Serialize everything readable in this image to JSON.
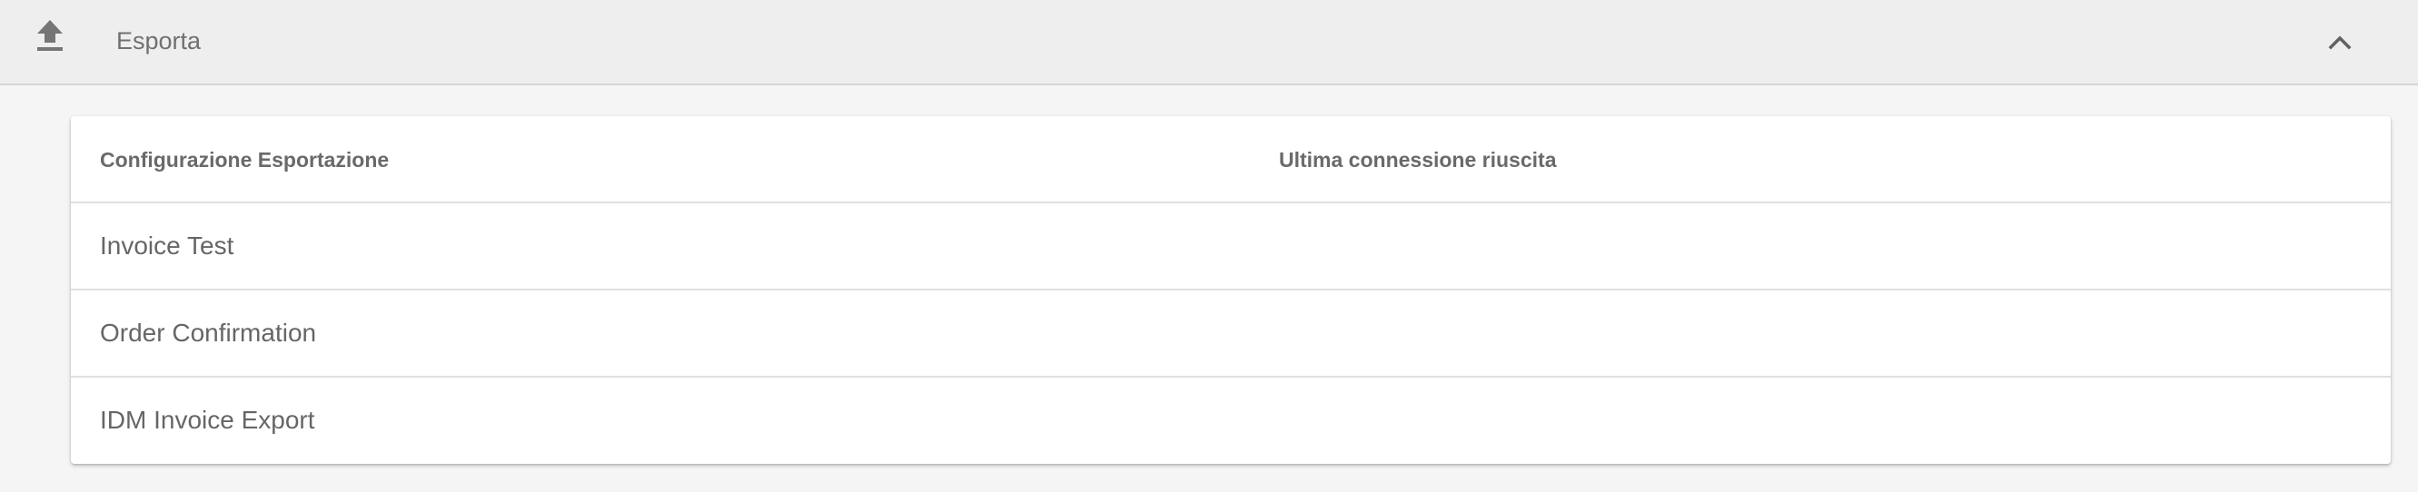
{
  "header": {
    "icon": "upload-icon",
    "title": "Esporta",
    "collapse_icon": "chevron-up-icon"
  },
  "table": {
    "columns": [
      "Configurazione Esportazione",
      "Ultima connessione riuscita"
    ],
    "rows": [
      {
        "name": "Invoice Test",
        "last_connection": ""
      },
      {
        "name": "Order Confirmation",
        "last_connection": ""
      },
      {
        "name": "IDM Invoice Export",
        "last_connection": ""
      }
    ]
  },
  "colors": {
    "header_bg": "#eeeeee",
    "page_bg": "#f5f5f5",
    "card_bg": "#ffffff",
    "text": "#666666",
    "divider": "#e0e0e0"
  }
}
